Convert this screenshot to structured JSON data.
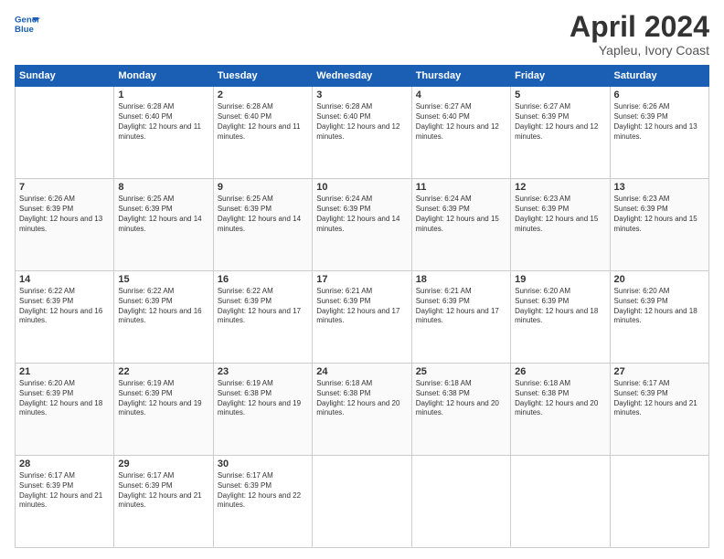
{
  "header": {
    "logo_line1": "General",
    "logo_line2": "Blue",
    "title": "April 2024",
    "subtitle": "Yapleu, Ivory Coast"
  },
  "weekdays": [
    "Sunday",
    "Monday",
    "Tuesday",
    "Wednesday",
    "Thursday",
    "Friday",
    "Saturday"
  ],
  "rows": [
    [
      {
        "day": "",
        "sunrise": "",
        "sunset": "",
        "daylight": ""
      },
      {
        "day": "1",
        "sunrise": "Sunrise: 6:28 AM",
        "sunset": "Sunset: 6:40 PM",
        "daylight": "Daylight: 12 hours and 11 minutes."
      },
      {
        "day": "2",
        "sunrise": "Sunrise: 6:28 AM",
        "sunset": "Sunset: 6:40 PM",
        "daylight": "Daylight: 12 hours and 11 minutes."
      },
      {
        "day": "3",
        "sunrise": "Sunrise: 6:28 AM",
        "sunset": "Sunset: 6:40 PM",
        "daylight": "Daylight: 12 hours and 12 minutes."
      },
      {
        "day": "4",
        "sunrise": "Sunrise: 6:27 AM",
        "sunset": "Sunset: 6:40 PM",
        "daylight": "Daylight: 12 hours and 12 minutes."
      },
      {
        "day": "5",
        "sunrise": "Sunrise: 6:27 AM",
        "sunset": "Sunset: 6:39 PM",
        "daylight": "Daylight: 12 hours and 12 minutes."
      },
      {
        "day": "6",
        "sunrise": "Sunrise: 6:26 AM",
        "sunset": "Sunset: 6:39 PM",
        "daylight": "Daylight: 12 hours and 13 minutes."
      }
    ],
    [
      {
        "day": "7",
        "sunrise": "Sunrise: 6:26 AM",
        "sunset": "Sunset: 6:39 PM",
        "daylight": "Daylight: 12 hours and 13 minutes."
      },
      {
        "day": "8",
        "sunrise": "Sunrise: 6:25 AM",
        "sunset": "Sunset: 6:39 PM",
        "daylight": "Daylight: 12 hours and 14 minutes."
      },
      {
        "day": "9",
        "sunrise": "Sunrise: 6:25 AM",
        "sunset": "Sunset: 6:39 PM",
        "daylight": "Daylight: 12 hours and 14 minutes."
      },
      {
        "day": "10",
        "sunrise": "Sunrise: 6:24 AM",
        "sunset": "Sunset: 6:39 PM",
        "daylight": "Daylight: 12 hours and 14 minutes."
      },
      {
        "day": "11",
        "sunrise": "Sunrise: 6:24 AM",
        "sunset": "Sunset: 6:39 PM",
        "daylight": "Daylight: 12 hours and 15 minutes."
      },
      {
        "day": "12",
        "sunrise": "Sunrise: 6:23 AM",
        "sunset": "Sunset: 6:39 PM",
        "daylight": "Daylight: 12 hours and 15 minutes."
      },
      {
        "day": "13",
        "sunrise": "Sunrise: 6:23 AM",
        "sunset": "Sunset: 6:39 PM",
        "daylight": "Daylight: 12 hours and 15 minutes."
      }
    ],
    [
      {
        "day": "14",
        "sunrise": "Sunrise: 6:22 AM",
        "sunset": "Sunset: 6:39 PM",
        "daylight": "Daylight: 12 hours and 16 minutes."
      },
      {
        "day": "15",
        "sunrise": "Sunrise: 6:22 AM",
        "sunset": "Sunset: 6:39 PM",
        "daylight": "Daylight: 12 hours and 16 minutes."
      },
      {
        "day": "16",
        "sunrise": "Sunrise: 6:22 AM",
        "sunset": "Sunset: 6:39 PM",
        "daylight": "Daylight: 12 hours and 17 minutes."
      },
      {
        "day": "17",
        "sunrise": "Sunrise: 6:21 AM",
        "sunset": "Sunset: 6:39 PM",
        "daylight": "Daylight: 12 hours and 17 minutes."
      },
      {
        "day": "18",
        "sunrise": "Sunrise: 6:21 AM",
        "sunset": "Sunset: 6:39 PM",
        "daylight": "Daylight: 12 hours and 17 minutes."
      },
      {
        "day": "19",
        "sunrise": "Sunrise: 6:20 AM",
        "sunset": "Sunset: 6:39 PM",
        "daylight": "Daylight: 12 hours and 18 minutes."
      },
      {
        "day": "20",
        "sunrise": "Sunrise: 6:20 AM",
        "sunset": "Sunset: 6:39 PM",
        "daylight": "Daylight: 12 hours and 18 minutes."
      }
    ],
    [
      {
        "day": "21",
        "sunrise": "Sunrise: 6:20 AM",
        "sunset": "Sunset: 6:39 PM",
        "daylight": "Daylight: 12 hours and 18 minutes."
      },
      {
        "day": "22",
        "sunrise": "Sunrise: 6:19 AM",
        "sunset": "Sunset: 6:39 PM",
        "daylight": "Daylight: 12 hours and 19 minutes."
      },
      {
        "day": "23",
        "sunrise": "Sunrise: 6:19 AM",
        "sunset": "Sunset: 6:38 PM",
        "daylight": "Daylight: 12 hours and 19 minutes."
      },
      {
        "day": "24",
        "sunrise": "Sunrise: 6:18 AM",
        "sunset": "Sunset: 6:38 PM",
        "daylight": "Daylight: 12 hours and 20 minutes."
      },
      {
        "day": "25",
        "sunrise": "Sunrise: 6:18 AM",
        "sunset": "Sunset: 6:38 PM",
        "daylight": "Daylight: 12 hours and 20 minutes."
      },
      {
        "day": "26",
        "sunrise": "Sunrise: 6:18 AM",
        "sunset": "Sunset: 6:38 PM",
        "daylight": "Daylight: 12 hours and 20 minutes."
      },
      {
        "day": "27",
        "sunrise": "Sunrise: 6:17 AM",
        "sunset": "Sunset: 6:39 PM",
        "daylight": "Daylight: 12 hours and 21 minutes."
      }
    ],
    [
      {
        "day": "28",
        "sunrise": "Sunrise: 6:17 AM",
        "sunset": "Sunset: 6:39 PM",
        "daylight": "Daylight: 12 hours and 21 minutes."
      },
      {
        "day": "29",
        "sunrise": "Sunrise: 6:17 AM",
        "sunset": "Sunset: 6:39 PM",
        "daylight": "Daylight: 12 hours and 21 minutes."
      },
      {
        "day": "30",
        "sunrise": "Sunrise: 6:17 AM",
        "sunset": "Sunset: 6:39 PM",
        "daylight": "Daylight: 12 hours and 22 minutes."
      },
      {
        "day": "",
        "sunrise": "",
        "sunset": "",
        "daylight": ""
      },
      {
        "day": "",
        "sunrise": "",
        "sunset": "",
        "daylight": ""
      },
      {
        "day": "",
        "sunrise": "",
        "sunset": "",
        "daylight": ""
      },
      {
        "day": "",
        "sunrise": "",
        "sunset": "",
        "daylight": ""
      }
    ]
  ]
}
